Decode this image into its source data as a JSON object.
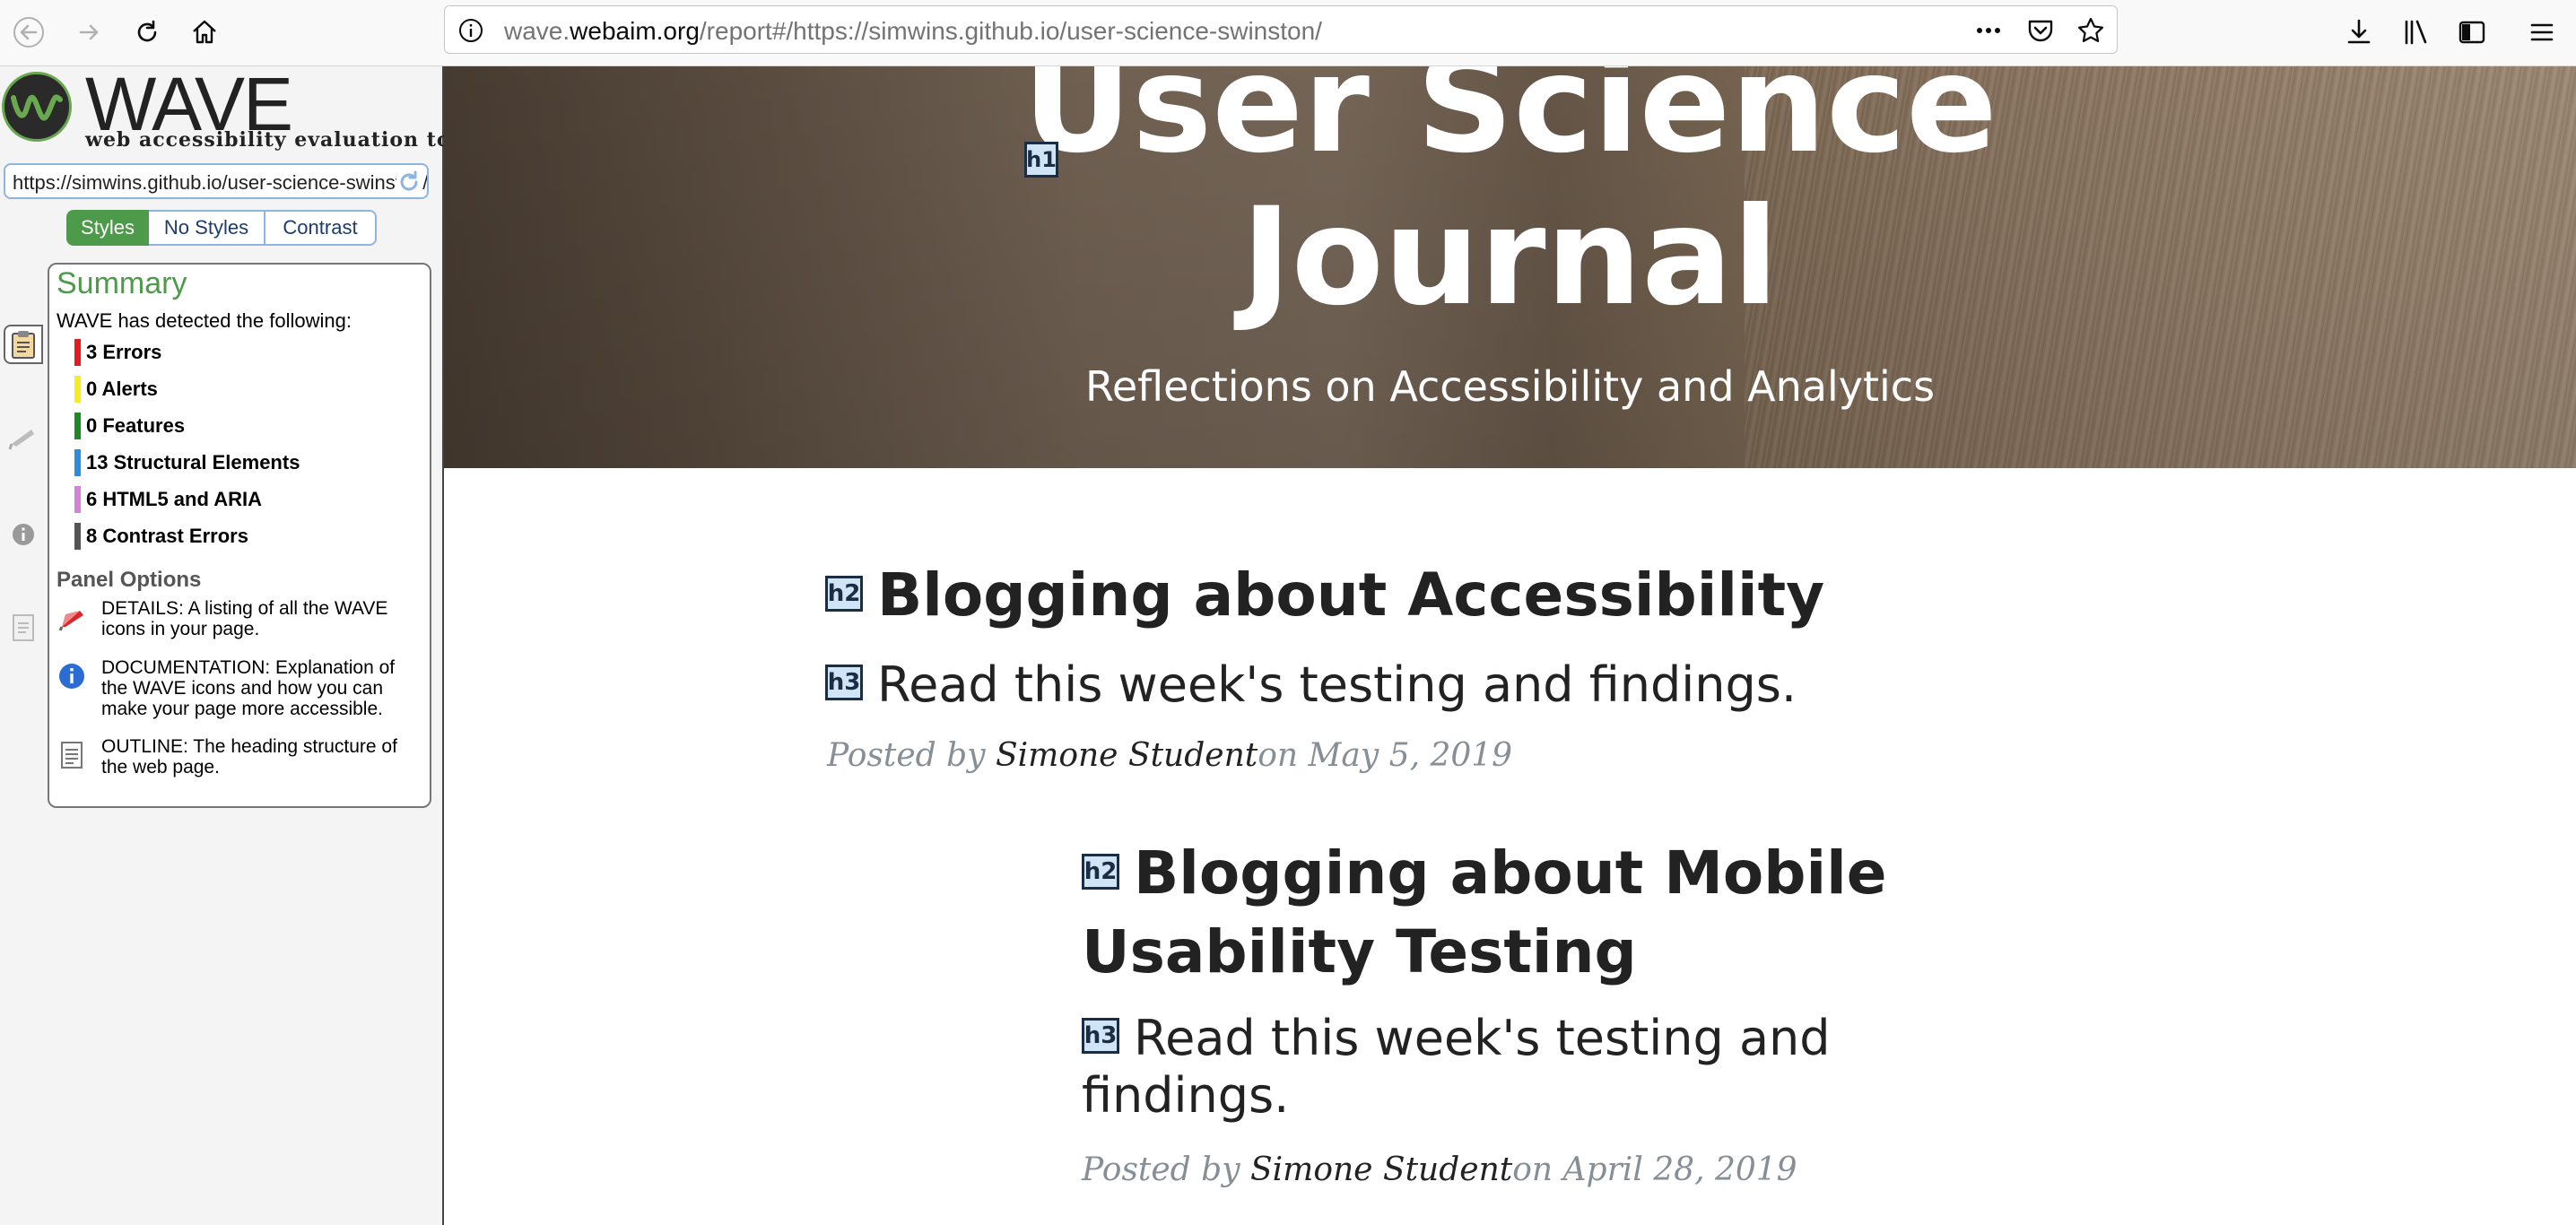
{
  "browser": {
    "url_prefix": "wave.",
    "url_domain": "webaim.org",
    "url_rest": "/report#/https://simwins.github.io/user-science-swinston/"
  },
  "wave": {
    "logo_word": "WAVE",
    "tagline": "web accessibility evaluation tool",
    "url_value": "https://simwins.github.io/user-science-swinston/",
    "modes": [
      "Styles",
      "No Styles",
      "Contrast"
    ],
    "summary": {
      "title": "Summary",
      "intro": "WAVE has detected the following:",
      "rows": [
        {
          "label": "3 Errors",
          "color": "#e8191f"
        },
        {
          "label": "0 Alerts",
          "color": "#f5ee1f"
        },
        {
          "label": "0 Features",
          "color": "#1e8a22"
        },
        {
          "label": "13 Structural Elements",
          "color": "#2b8de0"
        },
        {
          "label": "6 HTML5 and ARIA",
          "color": "#d680d6"
        },
        {
          "label": "8 Contrast Errors",
          "color": "#555555"
        }
      ],
      "panel_options_title": "Panel Options",
      "options": [
        {
          "text": "DETAILS: A listing of all the WAVE icons in your page.",
          "icon": "flag-icon"
        },
        {
          "text": "DOCUMENTATION: Explanation of the WAVE icons and how you can make your page more accessible.",
          "icon": "info-icon"
        },
        {
          "text": "OUTLINE: The heading structure of the web page.",
          "icon": "outline-icon"
        }
      ]
    }
  },
  "page": {
    "hero_title_line1": "User Science",
    "hero_title_line2": "Journal",
    "hero_subtitle": "Reflections on Accessibility and Analytics",
    "h1_badge": "h1",
    "posts": [
      {
        "h2_badge": "h2",
        "title": "Blogging about Accessibility",
        "h3_badge": "h3",
        "subtitle": "Read this week's testing and findings.",
        "posted_by": "Posted by ",
        "author": "Simone Student",
        "date": "on May 5, 2019"
      },
      {
        "h2_badge": "h2",
        "title_line1": "Blogging about Mobile",
        "title_line2": "Usability Testing",
        "h3_badge": "h3",
        "subtitle_line1": "Read this week's testing and",
        "subtitle_line2": "findings.",
        "posted_by": "Posted by ",
        "author": "Simone Student",
        "date": "on April 28, 2019"
      }
    ]
  }
}
